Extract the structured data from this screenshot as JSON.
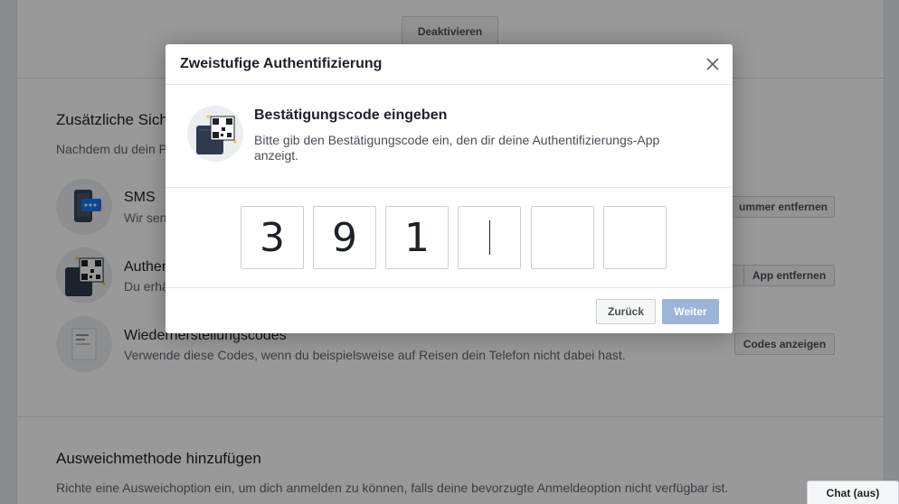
{
  "background": {
    "deactivate_label": "Deaktivieren",
    "extra_section": {
      "title": "Zusätzliche Sicherheit",
      "subtitle": "Nachdem du dein P"
    },
    "items": [
      {
        "title": "SMS",
        "desc": "Wir sen",
        "action": "ummer entfernen",
        "icon": "phone-icon"
      },
      {
        "title": "Authen",
        "desc": "Du erhä",
        "action": "App entfernen",
        "icon": "qr-code-icon"
      },
      {
        "title": "Wiederherstellungscodes",
        "desc": "Verwende diese Codes, wenn du beispielsweise auf Reisen dein Telefon nicht dabei hast.",
        "action": "Codes anzeigen",
        "icon": "document-icon"
      }
    ],
    "fallback_section": {
      "title": "Ausweichmethode hinzufügen",
      "subtitle": "Richte eine Ausweichoption ein, um dich anmelden zu können, falls deine bevorzugte Anmeldeoption nicht verfügbar ist."
    },
    "chat_label": "Chat (aus)"
  },
  "modal": {
    "title": "Zweistufige Authentifizierung",
    "close_icon": "close-icon",
    "heading": "Bestätigungscode eingeben",
    "description": "Bitte gib den Bestätigungscode ein, den dir deine Authentifizierungs-App anzeigt.",
    "code_digits": [
      "3",
      "9",
      "1",
      "",
      "",
      ""
    ],
    "active_digit_index": 3,
    "back_label": "Zurück",
    "next_label": "Weiter"
  },
  "colors": {
    "accent_disabled": "#9cb4d8",
    "text_primary": "#1d2129",
    "border": "#ccd0d5"
  }
}
